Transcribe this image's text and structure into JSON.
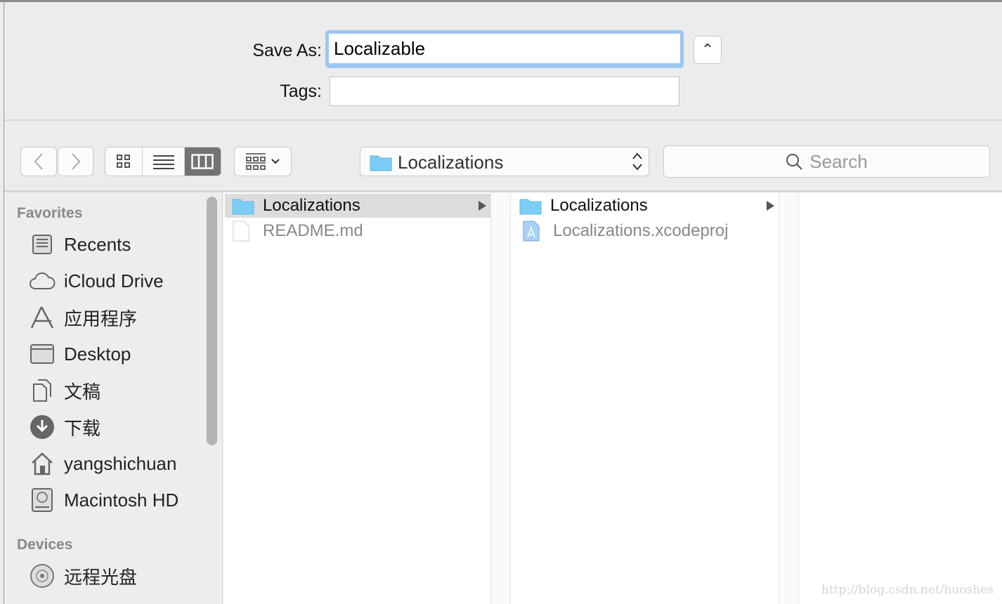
{
  "form": {
    "save_as_label": "Save As:",
    "save_as_value": "Localizable",
    "tags_label": "Tags:",
    "tags_value": ""
  },
  "toolbar": {
    "back": "back",
    "forward": "forward",
    "views": [
      "icon",
      "list",
      "column"
    ],
    "active_view": "column",
    "path": "Localizations",
    "search_placeholder": "Search"
  },
  "sidebar": {
    "favorites_header": "Favorites",
    "favorites": [
      {
        "label": "Recents",
        "icon": "recents-icon"
      },
      {
        "label": "iCloud Drive",
        "icon": "cloud-icon"
      },
      {
        "label": "应用程序",
        "icon": "applications-icon"
      },
      {
        "label": "Desktop",
        "icon": "desktop-icon"
      },
      {
        "label": "文稿",
        "icon": "documents-icon"
      },
      {
        "label": "下载",
        "icon": "download-icon"
      },
      {
        "label": "yangshichuan",
        "icon": "home-icon"
      },
      {
        "label": "Macintosh HD",
        "icon": "harddisk-icon"
      }
    ],
    "devices_header": "Devices",
    "devices": [
      {
        "label": "远程光盘",
        "icon": "disc-icon"
      }
    ]
  },
  "columns": [
    [
      {
        "name": "Localizations",
        "type": "folder",
        "selected": true
      },
      {
        "name": "README.md",
        "type": "file",
        "dimmed": true
      }
    ],
    [
      {
        "name": "Localizations",
        "type": "folder"
      },
      {
        "name": "Localizations.xcodeproj",
        "type": "xcodeproj",
        "dimmed": true
      }
    ]
  ],
  "watermark": "http://blog.csdn.net/huoshes",
  "colors": {
    "focus_ring": "#9ec6f1",
    "folder": "#7ccdf5",
    "selected_row": "#dcdcdc"
  }
}
